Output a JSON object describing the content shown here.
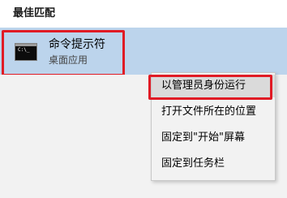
{
  "header": {
    "title": "最佳匹配"
  },
  "result": {
    "name": "命令提示符",
    "subtitle": "桌面应用",
    "icon": "command-prompt-icon",
    "icon_text": "C:\\_"
  },
  "context_menu": {
    "items": [
      {
        "label": "以管理员身份运行"
      },
      {
        "label": "打开文件所在的位置"
      },
      {
        "label": "固定到\"开始\"屏幕"
      },
      {
        "label": "固定到任务栏"
      }
    ]
  },
  "colors": {
    "selected_result_bg": "#bcd4ec",
    "annotation_red": "#e01b25",
    "menu_bg": "#f2f2f2"
  }
}
